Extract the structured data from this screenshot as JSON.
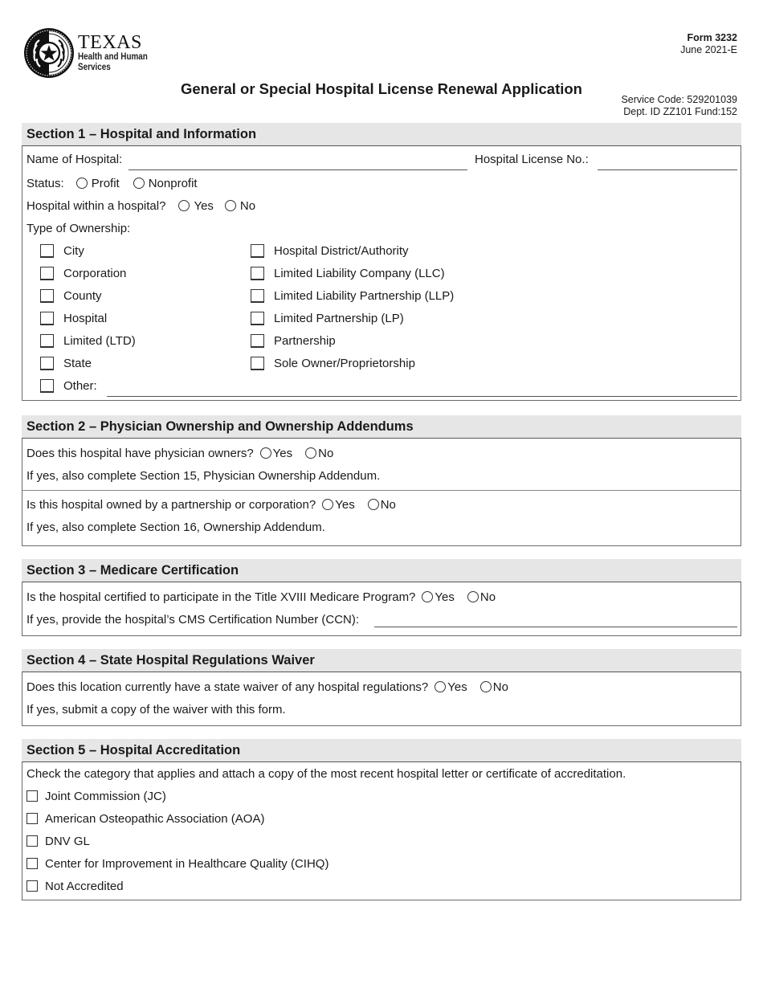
{
  "header": {
    "logo": {
      "icon": "texas-seal-icon",
      "line1": "TEXAS",
      "line2": "Health and Human",
      "line3": "Services"
    },
    "form_number": "Form 3232",
    "form_date": "June 2021-E",
    "title": "General or Special Hospital License Renewal Application",
    "service_code": "Service Code: 529201039",
    "dept_fund": "Dept. ID ZZ101 Fund:152"
  },
  "section1": {
    "title": "Section 1 – Hospital and Information",
    "name_label": "Name of Hospital:",
    "name_value": "",
    "license_label": "Hospital License No.:",
    "license_value": "",
    "status_label": "Status:",
    "status_options": [
      "Profit",
      "Nonprofit"
    ],
    "hwh_label": "Hospital within a hospital?",
    "hwh_options": [
      "Yes",
      "No"
    ],
    "ownership_label": "Type of Ownership:",
    "ownership_left": [
      "City",
      "Corporation",
      "County",
      "Hospital",
      "Limited (LTD)",
      "State",
      "Other:"
    ],
    "ownership_right": [
      "Hospital District/Authority",
      "Limited Liability Company (LLC)",
      "Limited Liability Partnership (LLP)",
      "Limited Partnership (LP)",
      "Partnership",
      "Sole Owner/Proprietorship"
    ],
    "other_value": ""
  },
  "section2": {
    "title": "Section 2 – Physician Ownership and Ownership Addendums",
    "q1": "Does this hospital have physician owners?",
    "q1_note": "If yes, also complete Section 15, Physician Ownership Addendum.",
    "q2": "Is this hospital owned by a partnership or corporation?",
    "q2_note": "If yes, also complete Section 16, Ownership Addendum.",
    "yes": "Yes",
    "no": "No"
  },
  "section3": {
    "title": "Section 3 – Medicare Certification",
    "q1": "Is the hospital certified to participate in the Title XVIII Medicare Program?",
    "ccn_label": "If yes, provide the hospital’s CMS Certification Number (CCN):",
    "ccn_value": "",
    "yes": "Yes",
    "no": "No"
  },
  "section4": {
    "title": "Section 4 – State Hospital Regulations Waiver",
    "q1": "Does this location currently have a state waiver of any hospital regulations?",
    "note": "If yes, submit a copy of the waiver with this form.",
    "yes": "Yes",
    "no": "No"
  },
  "section5": {
    "title": "Section 5 – Hospital Accreditation",
    "instructions": "Check the category that applies and attach a copy of the most recent hospital letter or certificate of accreditation.",
    "options": [
      "Joint Commission (JC)",
      "American Osteopathic Association (AOA)",
      "DNV GL",
      "Center for Improvement in Healthcare Quality (CIHQ)",
      "Not Accredited"
    ]
  }
}
